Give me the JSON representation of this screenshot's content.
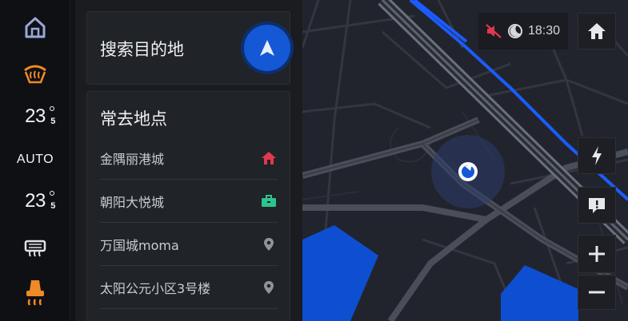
{
  "climate": {
    "left_temp": {
      "whole": "23",
      "decimal": "5"
    },
    "mode": "AUTO",
    "right_temp": {
      "whole": "23",
      "decimal": "5"
    },
    "icons": [
      "home-icon",
      "front-defrost-icon",
      "rear-defrost-icon",
      "seat-heat-icon"
    ]
  },
  "search": {
    "label": "搜索目的地"
  },
  "frequent": {
    "title": "常去地点",
    "places": [
      {
        "name": "金隅丽港城",
        "icon": "home-icon",
        "color": "#e0384f"
      },
      {
        "name": "朝阳大悦城",
        "icon": "briefcase-icon",
        "color": "#2fc48d"
      },
      {
        "name": "万国城moma",
        "icon": "location-pin-icon",
        "color": "#8f939a"
      },
      {
        "name": "太阳公元小区3号楼",
        "icon": "location-pin-icon",
        "color": "#8f939a"
      }
    ]
  },
  "status": {
    "time": "18:30"
  },
  "colors": {
    "accent": "#1458d6",
    "route": "#1a5cff",
    "orange": "#f08a24"
  }
}
